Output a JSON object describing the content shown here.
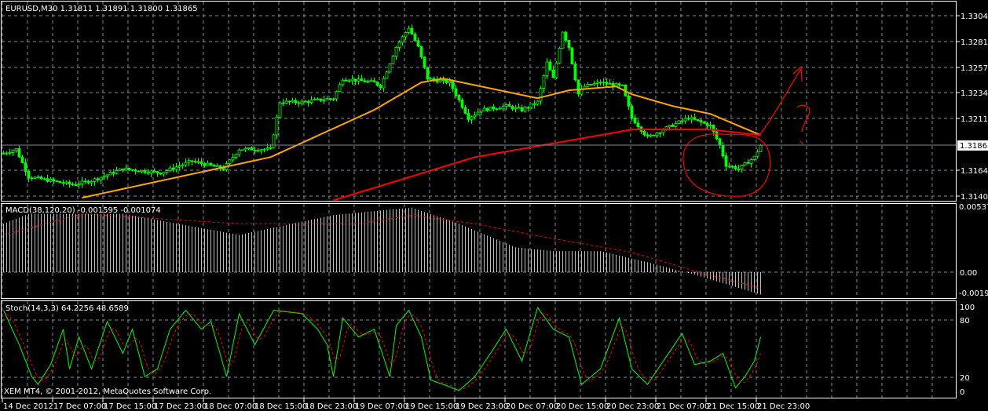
{
  "main": {
    "title": "EURUSD,M30  1.31811 1.31891 1.31800 1.31865",
    "price_ticks": [
      "1.33040",
      "1.32810",
      "1.32575",
      "1.32340",
      "1.32110",
      "1.31865",
      "1.31640",
      "1.31405"
    ],
    "current_price": "1.31865",
    "copyright": "XEM MT4, © 2001-2012, MetaQuotes Software Corp."
  },
  "macd": {
    "title": "MACD(38,120,20) -0.001595 -0.001074",
    "ticks": [
      "0.005373",
      "0.00",
      "-0.00193"
    ]
  },
  "stoch": {
    "title": "Stoch(14,3,3) 64.2256 48.6589",
    "ticks": [
      "100",
      "80",
      "20",
      "0"
    ]
  },
  "time_axis": [
    "14 Dec 2012",
    "17 Dec 07:00",
    "17 Dec 15:00",
    "17 Dec 23:00",
    "18 Dec 07:00",
    "18 Dec 15:00",
    "18 Dec 23:00",
    "19 Dec 07:00",
    "19 Dec 15:00",
    "19 Dec 23:00",
    "20 Dec 07:00",
    "20 Dec 15:00",
    "20 Dec 23:00",
    "21 Dec 07:00",
    "21 Dec 15:00",
    "21 Dec 23:00"
  ],
  "colors": {
    "candle": "#00ff00",
    "ma_fast": "#ffa500",
    "ma_slow": "#ff0000",
    "macd_hist": "#c0c0c0",
    "signal": "#ff0000",
    "stoch_main": "#00ff00",
    "grid": "#7f8c99",
    "annotation": "#ff0000"
  },
  "chart_data": {
    "type": "line",
    "price_range": [
      1.31405,
      1.3304
    ],
    "close_keyframes": [
      [
        0,
        1.31794
      ],
      [
        4,
        1.3183
      ],
      [
        8,
        1.3158
      ],
      [
        15,
        1.31545
      ],
      [
        22,
        1.31509
      ],
      [
        28,
        1.31545
      ],
      [
        38,
        1.31652
      ],
      [
        50,
        1.31616
      ],
      [
        60,
        1.31723
      ],
      [
        70,
        1.31652
      ],
      [
        75,
        1.3183
      ],
      [
        85,
        1.3183
      ],
      [
        88,
        1.32257
      ],
      [
        95,
        1.32257
      ],
      [
        105,
        1.32292
      ],
      [
        108,
        1.3247
      ],
      [
        118,
        1.32435
      ],
      [
        120,
        1.32399
      ],
      [
        125,
        1.32755
      ],
      [
        129,
        1.32933
      ],
      [
        132,
        1.32755
      ],
      [
        135,
        1.3247
      ],
      [
        142,
        1.32435
      ],
      [
        148,
        1.32114
      ],
      [
        152,
        1.32186
      ],
      [
        160,
        1.32221
      ],
      [
        165,
        1.32186
      ],
      [
        170,
        1.32257
      ],
      [
        173,
        1.32613
      ],
      [
        175,
        1.3247
      ],
      [
        178,
        1.32898
      ],
      [
        180,
        1.32755
      ],
      [
        183,
        1.32328
      ],
      [
        185,
        1.32399
      ],
      [
        190,
        1.32435
      ],
      [
        197,
        1.32399
      ],
      [
        200,
        1.32114
      ],
      [
        205,
        1.31936
      ],
      [
        210,
        1.32008
      ],
      [
        218,
        1.32114
      ],
      [
        225,
        1.32043
      ],
      [
        228,
        1.31865
      ],
      [
        230,
        1.31687
      ],
      [
        234,
        1.31652
      ],
      [
        239,
        1.31758
      ],
      [
        241,
        1.31865
      ]
    ],
    "ma_fast_keyframes": [
      [
        25,
        1.3139
      ],
      [
        85,
        1.31758
      ],
      [
        118,
        1.32186
      ],
      [
        133,
        1.32435
      ],
      [
        140,
        1.3247
      ],
      [
        170,
        1.32292
      ],
      [
        180,
        1.32364
      ],
      [
        195,
        1.32399
      ],
      [
        200,
        1.32328
      ],
      [
        213,
        1.32221
      ],
      [
        225,
        1.3215
      ],
      [
        241,
        1.31958
      ]
    ],
    "ma_slow_keyframes": [
      [
        105,
        1.31367
      ],
      [
        150,
        1.31758
      ],
      [
        200,
        1.32008
      ],
      [
        225,
        1.32008
      ],
      [
        241,
        1.31958
      ]
    ],
    "macd_range": [
      -0.00193,
      0.005373
    ],
    "macd_hist_keyframes": [
      [
        0,
        0.0039
      ],
      [
        8,
        0.0047
      ],
      [
        38,
        0.0047
      ],
      [
        75,
        0.003
      ],
      [
        105,
        0.0046
      ],
      [
        130,
        0.0052
      ],
      [
        145,
        0.0039
      ],
      [
        163,
        0.002
      ],
      [
        175,
        0.0017
      ],
      [
        190,
        0.0017
      ],
      [
        205,
        0.0008
      ],
      [
        220,
        -0.0002
      ],
      [
        241,
        -0.0018
      ]
    ],
    "macd_signal_keyframes": [
      [
        0,
        0.003
      ],
      [
        25,
        0.0047
      ],
      [
        75,
        0.0039
      ],
      [
        113,
        0.0039
      ],
      [
        130,
        0.0046
      ],
      [
        150,
        0.0039
      ],
      [
        175,
        0.0027
      ],
      [
        200,
        0.0016
      ],
      [
        220,
        0.0001
      ],
      [
        241,
        -0.0013
      ]
    ],
    "stoch_range": [
      0,
      100
    ],
    "stoch_levels": [
      20,
      80
    ],
    "stoch_keyframes": [
      [
        0,
        95
      ],
      [
        5,
        55
      ],
      [
        9,
        18
      ],
      [
        11,
        9
      ],
      [
        15,
        32
      ],
      [
        19,
        73
      ],
      [
        21,
        27
      ],
      [
        24,
        64
      ],
      [
        28,
        27
      ],
      [
        33,
        82
      ],
      [
        38,
        45
      ],
      [
        41,
        73
      ],
      [
        45,
        18
      ],
      [
        49,
        27
      ],
      [
        53,
        73
      ],
      [
        58,
        95
      ],
      [
        63,
        73
      ],
      [
        66,
        82
      ],
      [
        71,
        18
      ],
      [
        75,
        91
      ],
      [
        80,
        55
      ],
      [
        86,
        95
      ],
      [
        95,
        91
      ],
      [
        100,
        73
      ],
      [
        103,
        55
      ],
      [
        105,
        18
      ],
      [
        108,
        86
      ],
      [
        113,
        64
      ],
      [
        118,
        73
      ],
      [
        123,
        18
      ],
      [
        125,
        77
      ],
      [
        129,
        95
      ],
      [
        133,
        64
      ],
      [
        136,
        14
      ],
      [
        140,
        9
      ],
      [
        145,
        2
      ],
      [
        150,
        18
      ],
      [
        155,
        45
      ],
      [
        160,
        73
      ],
      [
        165,
        36
      ],
      [
        170,
        98
      ],
      [
        175,
        73
      ],
      [
        180,
        64
      ],
      [
        184,
        9
      ],
      [
        190,
        27
      ],
      [
        196,
        86
      ],
      [
        200,
        27
      ],
      [
        205,
        9
      ],
      [
        210,
        36
      ],
      [
        216,
        68
      ],
      [
        220,
        32
      ],
      [
        225,
        36
      ],
      [
        229,
        45
      ],
      [
        233,
        5
      ],
      [
        236,
        18
      ],
      [
        239,
        36
      ],
      [
        241,
        64
      ]
    ]
  }
}
